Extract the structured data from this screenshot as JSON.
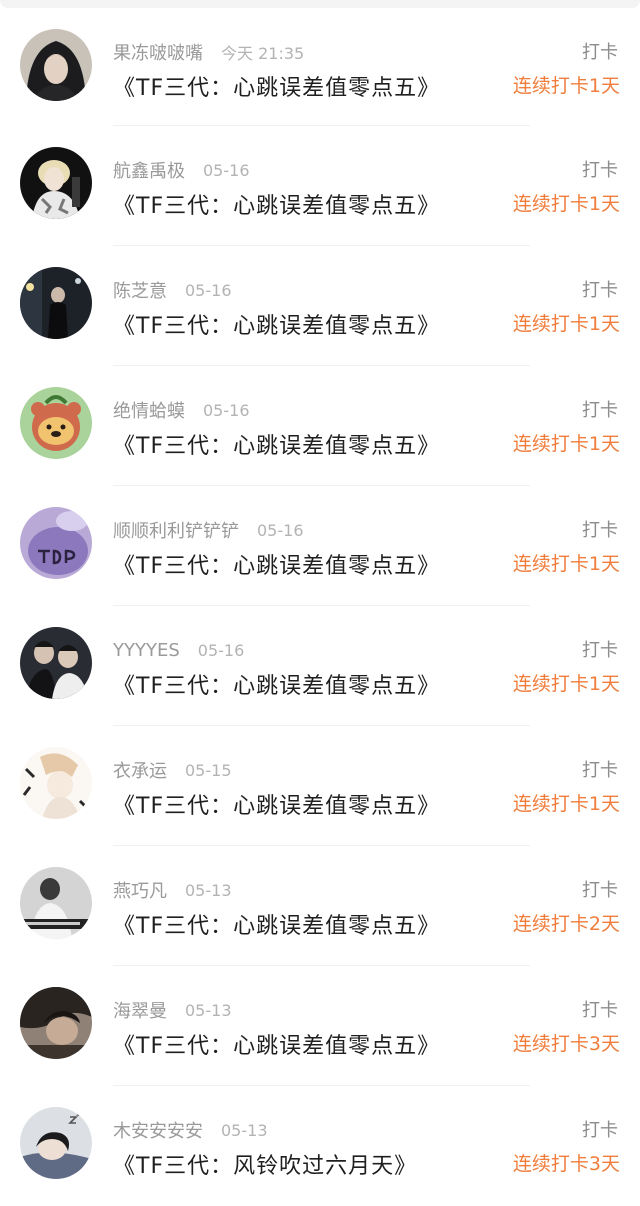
{
  "feed": {
    "items": [
      {
        "user": "果冻啵啵嘴",
        "time": "今天 21:35",
        "book": "《TF三代：心跳误差值零点五》",
        "type": "打卡",
        "streak": "连续打卡1天",
        "avatar": "dark-hooded-avatar"
      },
      {
        "user": "航鑫禹极",
        "time": "05-16",
        "book": "《TF三代：心跳误差值零点五》",
        "type": "打卡",
        "streak": "连续打卡1天",
        "avatar": "blond-boy-avatar"
      },
      {
        "user": "陈芝意",
        "time": "05-16",
        "book": "《TF三代：心跳误差值零点五》",
        "type": "打卡",
        "streak": "连续打卡1天",
        "avatar": "night-street-avatar"
      },
      {
        "user": "绝情蛤蟆",
        "time": "05-16",
        "book": "《TF三代：心跳误差值零点五》",
        "type": "打卡",
        "streak": "连续打卡1天",
        "avatar": "cartoon-bear-avatar"
      },
      {
        "user": "顺顺利利铲铲铲",
        "time": "05-16",
        "book": "《TF三代：心跳误差值零点五》",
        "type": "打卡",
        "streak": "连续打卡1天",
        "avatar": "purple-tdp-avatar"
      },
      {
        "user": "YYYYES",
        "time": "05-16",
        "book": "《TF三代：心跳误差值零点五》",
        "type": "打卡",
        "streak": "连续打卡1天",
        "avatar": "two-boys-avatar"
      },
      {
        "user": "衣承运",
        "time": "05-15",
        "book": "《TF三代：心跳误差值零点五》",
        "type": "打卡",
        "streak": "连续打卡1天",
        "avatar": "anime-boy-avatar"
      },
      {
        "user": "燕巧凡",
        "time": "05-13",
        "book": "《TF三代：心跳误差值零点五》",
        "type": "打卡",
        "streak": "连续打卡2天",
        "avatar": "jersey-27-avatar"
      },
      {
        "user": "海翠曼",
        "time": "05-13",
        "book": "《TF三代：心跳误差值零点五》",
        "type": "打卡",
        "streak": "连续打卡3天",
        "avatar": "dark-hair-avatar"
      },
      {
        "user": "木安安安安",
        "time": "05-13",
        "book": "《TF三代：风铃吹过六月天》",
        "type": "打卡",
        "streak": "连续打卡3天",
        "avatar": "sleeping-girl-avatar"
      }
    ]
  },
  "colors": {
    "accent": "#f07d3c",
    "username": "#9a9a9a",
    "time": "#b3b3b3",
    "title": "#1f1f1f"
  }
}
